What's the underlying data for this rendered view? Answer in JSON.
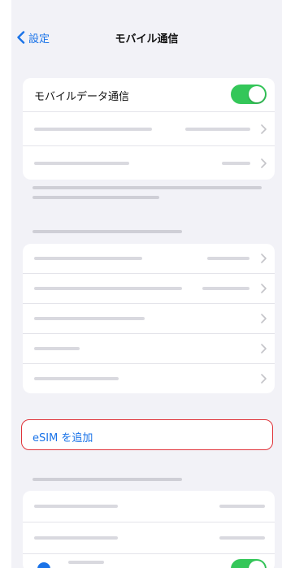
{
  "nav": {
    "back_label": "設定",
    "title": "モバイル通信"
  },
  "cellular": {
    "mobile_data_label": "モバイルデータ通信",
    "mobile_data_on": true
  },
  "esim": {
    "add_label": "eSIM を追加"
  },
  "colors": {
    "accent": "#1a73e8",
    "toggle_on": "#34c759",
    "highlight_border": "#e0343a",
    "background": "#f2f2f7"
  },
  "icons": {
    "back": "chevron-left-icon",
    "disclosure": "chevron-right-icon"
  }
}
